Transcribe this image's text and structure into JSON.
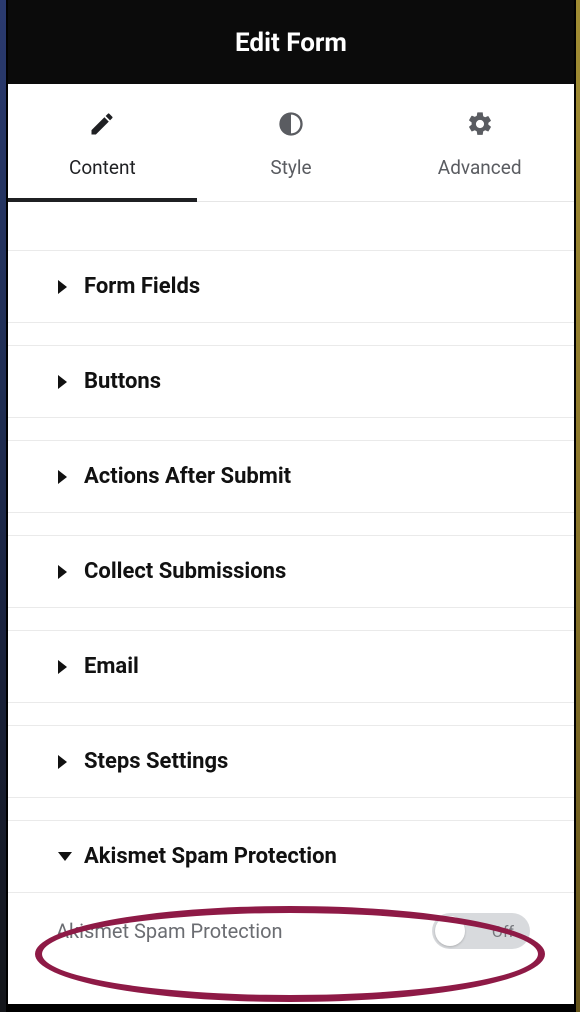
{
  "header": {
    "title": "Edit Form"
  },
  "tabs": [
    {
      "id": "content",
      "label": "Content",
      "icon": "pencil-icon",
      "active": true
    },
    {
      "id": "style",
      "label": "Style",
      "icon": "contrast-icon",
      "active": false
    },
    {
      "id": "advanced",
      "label": "Advanced",
      "icon": "gear-icon",
      "active": false
    }
  ],
  "sections": [
    {
      "label": "Form Fields",
      "expanded": false
    },
    {
      "label": "Buttons",
      "expanded": false
    },
    {
      "label": "Actions After Submit",
      "expanded": false
    },
    {
      "label": "Collect Submissions",
      "expanded": false
    },
    {
      "label": "Email",
      "expanded": false
    },
    {
      "label": "Steps Settings",
      "expanded": false
    },
    {
      "label": "Akismet Spam Protection",
      "expanded": true,
      "setting": {
        "label": "Akismet Spam Protection",
        "state": "Off",
        "value": false
      }
    }
  ],
  "annotation": {
    "color": "#8e1a46"
  }
}
